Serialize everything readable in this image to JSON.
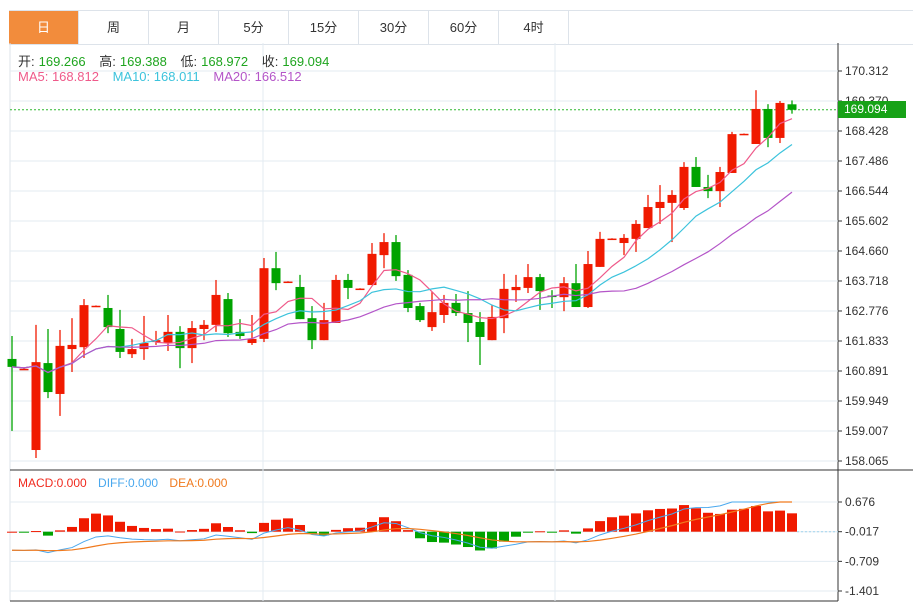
{
  "tabs": [
    "日",
    "周",
    "月",
    "5分",
    "15分",
    "30分",
    "60分",
    "4时"
  ],
  "active_tab": 0,
  "ohlc": {
    "open_label": "开:",
    "open": "169.266",
    "high_label": "高:",
    "high": "169.388",
    "low_label": "低:",
    "low": "168.972",
    "close_label": "收:",
    "close": "169.094"
  },
  "ma": {
    "ma5": "MA5: 168.812",
    "ma10": "MA10: 168.011",
    "ma20": "MA20: 166.512"
  },
  "last_price": "169.094",
  "macd_labels": {
    "macd": "MACD:0.000",
    "diff": "DIFF:0.000",
    "dea": "DEA:0.000"
  },
  "colors": {
    "up": "#f01a00",
    "down": "#00a300",
    "ma5": "#ef5a8a",
    "ma10": "#3cc3dc",
    "ma20": "#b455c8",
    "diff": "#4aa8ee",
    "dea": "#f07a1e",
    "accent": "#f28c3c"
  },
  "chart_data": {
    "type": "candlestick",
    "price_axis": {
      "ticks": [
        "170.312",
        "169.370",
        "168.428",
        "167.486",
        "166.544",
        "165.602",
        "164.660",
        "163.718",
        "162.776",
        "161.833",
        "160.891",
        "159.949",
        "159.007",
        "158.065"
      ],
      "range": [
        158.065,
        170.312
      ]
    },
    "macd_axis": {
      "ticks": [
        "0.676",
        "-0.017",
        "-0.709",
        "-1.401"
      ],
      "range": [
        -1.401,
        0.676
      ]
    },
    "candles": [
      [
        161.27,
        161.99,
        159.01,
        161.02
      ],
      [
        160.95,
        160.97,
        160.93,
        160.96
      ],
      [
        158.41,
        162.34,
        158.16,
        161.17
      ],
      [
        161.14,
        162.21,
        160.04,
        160.23
      ],
      [
        160.17,
        162.18,
        159.48,
        161.68
      ],
      [
        161.58,
        162.55,
        160.86,
        161.71
      ],
      [
        161.64,
        163.15,
        161.3,
        162.96
      ],
      [
        162.93,
        162.95,
        162.91,
        162.94
      ],
      [
        162.87,
        163.28,
        162.08,
        162.27
      ],
      [
        162.21,
        162.81,
        161.3,
        161.49
      ],
      [
        161.42,
        161.9,
        161.3,
        161.58
      ],
      [
        161.58,
        162.62,
        161.24,
        161.77
      ],
      [
        161.8,
        162.15,
        161.71,
        161.86
      ],
      [
        161.77,
        162.65,
        161.52,
        162.12
      ],
      [
        162.12,
        162.3,
        160.98,
        161.61
      ],
      [
        161.61,
        162.46,
        161.14,
        162.24
      ],
      [
        162.21,
        162.49,
        161.86,
        162.34
      ],
      [
        162.34,
        163.75,
        162.12,
        163.28
      ],
      [
        163.15,
        163.34,
        161.96,
        162.08
      ],
      [
        162.12,
        162.52,
        161.9,
        161.99
      ],
      [
        161.77,
        162.65,
        161.71,
        161.9
      ],
      [
        161.9,
        164.44,
        161.8,
        164.12
      ],
      [
        164.12,
        164.63,
        163.43,
        163.65
      ],
      [
        163.69,
        163.71,
        163.67,
        163.7
      ],
      [
        163.53,
        163.91,
        162.52,
        162.52
      ],
      [
        162.55,
        162.93,
        161.58,
        161.86
      ],
      [
        161.86,
        163.03,
        161.86,
        162.49
      ],
      [
        162.4,
        163.91,
        162.4,
        163.75
      ],
      [
        163.75,
        163.94,
        163.15,
        163.5
      ],
      [
        163.47,
        163.49,
        163.45,
        163.48
      ],
      [
        163.59,
        164.91,
        163.59,
        164.57
      ],
      [
        164.53,
        165.22,
        164.12,
        164.94
      ],
      [
        164.94,
        165.16,
        163.72,
        163.87
      ],
      [
        163.91,
        164.06,
        162.74,
        162.87
      ],
      [
        162.93,
        163.03,
        162.43,
        162.49
      ],
      [
        162.27,
        163.37,
        162.15,
        162.74
      ],
      [
        162.65,
        163.28,
        162.4,
        163.03
      ],
      [
        163.03,
        163.31,
        162.62,
        162.71
      ],
      [
        162.71,
        163.4,
        161.8,
        162.4
      ],
      [
        162.43,
        162.74,
        161.08,
        161.96
      ],
      [
        161.86,
        162.96,
        161.86,
        162.59
      ],
      [
        162.55,
        163.94,
        162.08,
        163.47
      ],
      [
        163.43,
        163.91,
        163.06,
        163.53
      ],
      [
        163.5,
        164.25,
        163.34,
        163.84
      ],
      [
        163.84,
        163.94,
        162.81,
        163.4
      ],
      [
        163.26,
        163.43,
        162.87,
        163.25
      ],
      [
        163.21,
        163.84,
        162.77,
        163.65
      ],
      [
        163.65,
        164.25,
        162.9,
        162.9
      ],
      [
        162.9,
        164.66,
        162.87,
        164.25
      ],
      [
        164.16,
        165.26,
        164.16,
        165.04
      ],
      [
        165.04,
        165.06,
        165.02,
        165.05
      ],
      [
        164.91,
        165.19,
        164.53,
        165.07
      ],
      [
        165.04,
        165.63,
        164.63,
        165.51
      ],
      [
        165.38,
        166.42,
        165.38,
        166.04
      ],
      [
        166.01,
        166.73,
        165.51,
        166.2
      ],
      [
        166.17,
        166.57,
        164.94,
        166.42
      ],
      [
        166.01,
        167.45,
        165.95,
        167.3
      ],
      [
        167.3,
        167.61,
        166.67,
        166.67
      ],
      [
        166.67,
        167.05,
        166.32,
        166.54
      ],
      [
        166.54,
        167.3,
        166.04,
        167.14
      ],
      [
        167.11,
        168.4,
        167.11,
        168.33
      ],
      [
        168.33,
        168.35,
        168.31,
        168.34
      ],
      [
        168.02,
        169.71,
        168.02,
        169.12
      ],
      [
        169.12,
        169.27,
        167.92,
        168.21
      ],
      [
        168.21,
        169.37,
        168.05,
        169.31
      ],
      [
        169.266,
        169.388,
        168.972,
        169.094
      ]
    ]
  }
}
